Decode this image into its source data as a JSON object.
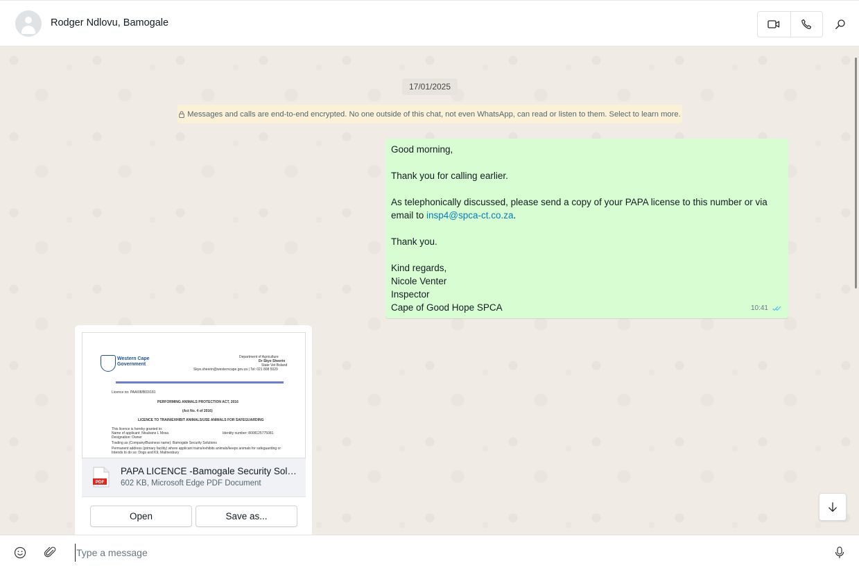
{
  "header": {
    "contact_name": "Rodger Ndlovu, Bamogale",
    "icons": {
      "avatar": "default-avatar",
      "video": "video-camera-icon",
      "voice": "phone-icon",
      "search": "search-icon"
    }
  },
  "chat": {
    "date_chip": "17/01/2025",
    "encryption_notice": "Messages and calls are end-to-end encrypted. No one outside of this chat, not even WhatsApp, can read or listen to them. Select to learn more.",
    "outgoing_message": {
      "greeting": "Good morning,",
      "line2": "Thank you for calling earlier.",
      "line3_pre": "As telephonically discussed, please send a copy of your PAPA license to this number or via email to ",
      "line3_link": "insp4@spca-ct.co.za",
      "line3_post": ".",
      "line4": "Thank you.",
      "sign1": "Kind regards,",
      "sign2": "Nicole Venter",
      "sign3": "Inspector",
      "sign4": "Cape of Good Hope SPCA",
      "time": "10:41",
      "status": "read"
    },
    "incoming_document": {
      "preview": {
        "org": "Western Cape Government",
        "dept": "Department of Agriculture",
        "officer": "Dr Skye Sheerin",
        "office": "State Vet Boland",
        "contact": "Skye.sheerin@westerncape.gov.za | Tel: 021 808 5029",
        "licence_no": "Licence no: PAA/08/B03/181",
        "act": "PERFORMING ANIMALS PROTECTION ACT, 2016",
        "act_no": "(Act No. 4 of 2016)",
        "licence_type": "LICENCE TO TRAIN/EXHIBIT ANIMALS/USE ANIMALS FOR SAFEGUARDING",
        "granted": "This licence is hereby granted to:",
        "applicant": "Name of applicant: Ntsubane L Mosa",
        "identity": "Identity number: 8008125775081",
        "designation": "Designation: Owner",
        "trading": "Trading as (Company/Business name): Bamogale Security Solutions",
        "address": "Permanent address (primary facility) where applicant trains/exhibits animals/keeps animals for safeguarding or",
        "intends": "Intends to do so: Dogs and K9, Malmesbury"
      },
      "file_name": "PAPA LICENCE -Bamogale Security Solutions.pdf",
      "file_meta": "602 KB, Microsoft Edge PDF Document",
      "open_label": "Open",
      "save_label": "Save as..."
    }
  },
  "composer": {
    "placeholder": "Type a message",
    "icons": {
      "emoji": "emoji-icon",
      "attach": "paperclip-icon",
      "mic": "microphone-icon"
    }
  },
  "colors": {
    "outgoing_bubble": "#d9fdd3",
    "link": "#027eb5",
    "encryption_bg": "#fbf1d6",
    "chat_bg": "#f0ebe4"
  }
}
